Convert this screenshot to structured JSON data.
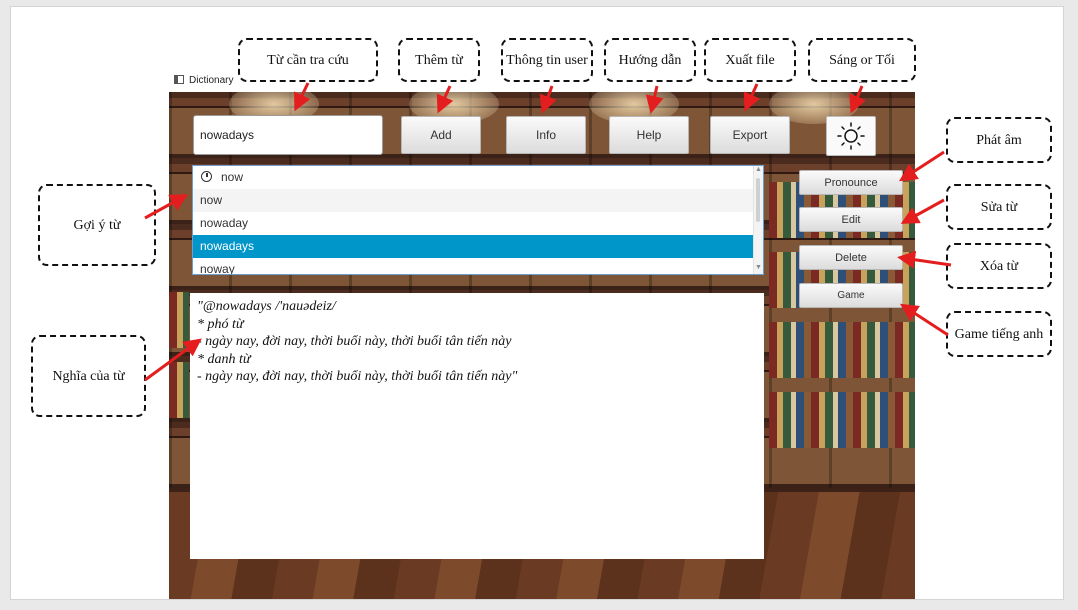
{
  "window": {
    "title": "Dictionary",
    "minimize_glyph": "—",
    "maximize_glyph": "□",
    "close_glyph": "✕"
  },
  "toolbar": {
    "search_value": "nowadays",
    "add_label": "Add",
    "info_label": "Info",
    "help_label": "Help",
    "export_label": "Export",
    "theme_icon": "sun-icon"
  },
  "sidebar": {
    "pronounce_label": "Pronounce",
    "edit_label": "Edit",
    "delete_label": "Delete",
    "game_label": "Game"
  },
  "suggestions": [
    {
      "text": "now",
      "kind": "history"
    },
    {
      "text": "now",
      "kind": "normal"
    },
    {
      "text": "nowaday",
      "kind": "normal"
    },
    {
      "text": "nowadays",
      "kind": "selected"
    },
    {
      "text": "noway",
      "kind": "normal"
    }
  ],
  "meaning": {
    "lines": [
      "\"@nowadays /'nauədeiz/",
      "* phó từ",
      "- ngày nay, đời nay, thời buổi này, thời buổi tân tiến này",
      "* danh từ",
      "- ngày nay, đời nay, thời buổi này, thời buổi tân tiến này\""
    ]
  },
  "annotations": {
    "lookup_word": "Từ cần tra cứu",
    "add_word": "Thêm từ",
    "user_info": "Thông tin user",
    "guide": "Hướng dẫn",
    "export_file": "Xuất file",
    "light_dark": "Sáng or Tối",
    "pronunciation": "Phát âm",
    "edit_word": "Sửa từ",
    "delete_word": "Xóa từ",
    "english_game": "Game tiếng anh",
    "word_suggestion": "Gợi ý từ",
    "word_meaning": "Nghĩa của từ"
  },
  "colors": {
    "selection": "#0096c9",
    "arrow": "#e41e1e",
    "list_border": "#6a9fd4"
  }
}
